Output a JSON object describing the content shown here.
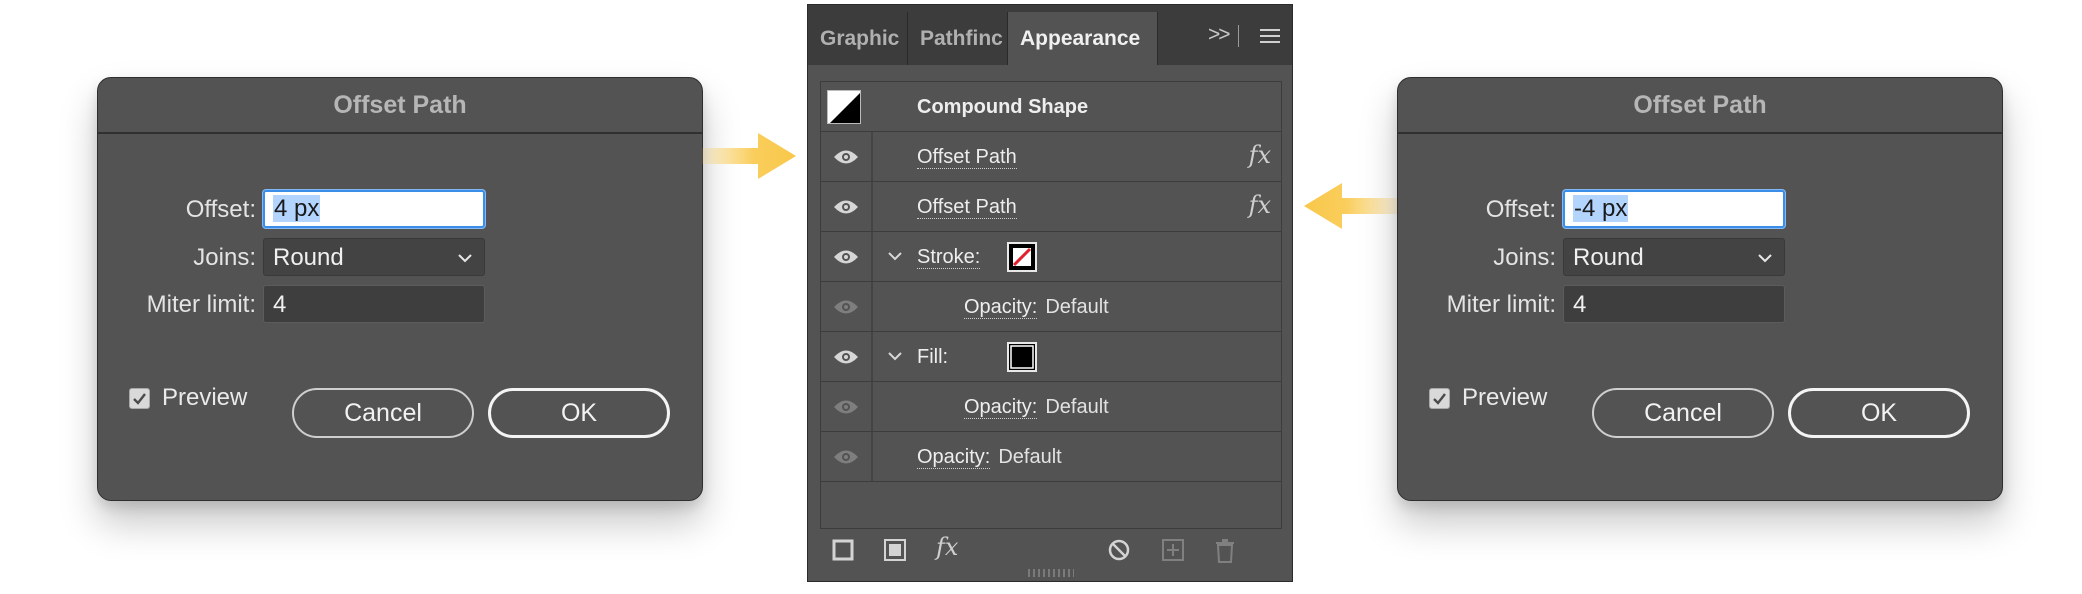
{
  "dialog_left": {
    "title": "Offset Path",
    "offset_label": "Offset:",
    "offset_value": "4 px",
    "joins_label": "Joins:",
    "joins_value": "Round",
    "miter_label": "Miter limit:",
    "miter_value": "4",
    "preview_label": "Preview",
    "preview_checked": true,
    "cancel_label": "Cancel",
    "ok_label": "OK"
  },
  "dialog_right": {
    "title": "Offset Path",
    "offset_label": "Offset:",
    "offset_value": "-4 px",
    "joins_label": "Joins:",
    "joins_value": "Round",
    "miter_label": "Miter limit:",
    "miter_value": "4",
    "preview_label": "Preview",
    "preview_checked": true,
    "cancel_label": "Cancel",
    "ok_label": "OK"
  },
  "panel": {
    "tabs": [
      {
        "label": "Graphic",
        "active": false
      },
      {
        "label": "Pathfinc",
        "active": false
      },
      {
        "label": "Appearance",
        "active": true
      }
    ],
    "overflow_glyph": ">>",
    "object_name": "Compound Shape",
    "rows": {
      "effect_1": "Offset Path",
      "effect_2": "Offset Path",
      "fx_symbol": "fx",
      "stroke_label": "Stroke:",
      "stroke_opacity_label": "Opacity:",
      "stroke_opacity_value": "Default",
      "fill_label": "Fill:",
      "fill_opacity_label": "Opacity:",
      "fill_opacity_value": "Default",
      "object_opacity_label": "Opacity:",
      "object_opacity_value": "Default"
    },
    "footer_icons": [
      "add-stroke-icon",
      "add-fill-icon",
      "add-effect-icon",
      "clear-appearance-icon",
      "duplicate-item-icon",
      "delete-item-icon"
    ],
    "footer_fx": "fx"
  },
  "colors": {
    "accent": "#f9c84a",
    "dialog_bg": "#535353",
    "focus_ring": "#3b8ee8",
    "selection": "#b3d4fc",
    "stroke_swatch_red": "#e0202e"
  }
}
